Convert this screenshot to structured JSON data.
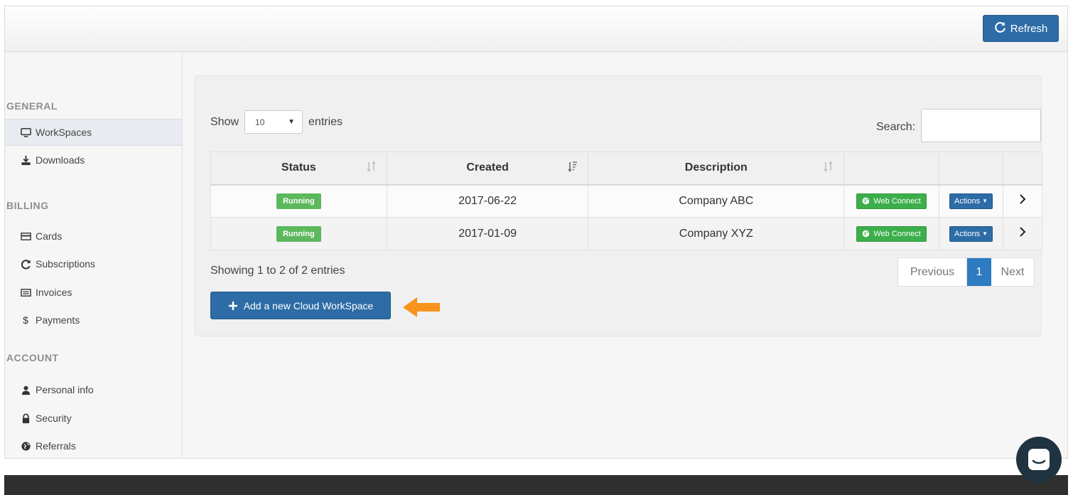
{
  "header": {
    "refresh_label": "Refresh"
  },
  "sidebar": {
    "sections": [
      {
        "title": "GENERAL"
      },
      {
        "title": "BILLING"
      },
      {
        "title": "ACCOUNT"
      }
    ],
    "items": [
      {
        "label": "WorkSpaces",
        "icon": "monitor-icon",
        "active": true
      },
      {
        "label": "Downloads",
        "icon": "download-icon"
      },
      {
        "label": "Cards",
        "icon": "card-icon"
      },
      {
        "label": "Subscriptions",
        "icon": "refresh-icon"
      },
      {
        "label": "Invoices",
        "icon": "invoice-icon"
      },
      {
        "label": "Payments",
        "icon": "dollar-icon"
      },
      {
        "label": "Personal info",
        "icon": "user-icon"
      },
      {
        "label": "Security",
        "icon": "lock-icon"
      },
      {
        "label": "Referrals",
        "icon": "globe-icon"
      }
    ]
  },
  "table_controls": {
    "show_label": "Show",
    "entries_value": "10",
    "entries_label": "entries",
    "search_label": "Search:",
    "search_value": ""
  },
  "table": {
    "columns": [
      "Status",
      "Created",
      "Description",
      "",
      "",
      ""
    ],
    "rows": [
      {
        "status": "Running",
        "created": "2017-06-22",
        "description": "Company ABC",
        "web_connect": "Web Connect",
        "actions": "Actions"
      },
      {
        "status": "Running",
        "created": "2017-01-09",
        "description": "Company XYZ",
        "web_connect": "Web Connect",
        "actions": "Actions"
      }
    ]
  },
  "footer_info": {
    "showing": "Showing 1 to 2 of 2 entries",
    "prev": "Previous",
    "current_page": "1",
    "next": "Next"
  },
  "add_button": {
    "label": "Add a new Cloud WorkSpace"
  },
  "colors": {
    "primary": "#2d6ca6",
    "success": "#5cb85c",
    "web_connect": "#3cae4b",
    "arrow": "#f7941d",
    "footer": "#2f2f2f"
  }
}
